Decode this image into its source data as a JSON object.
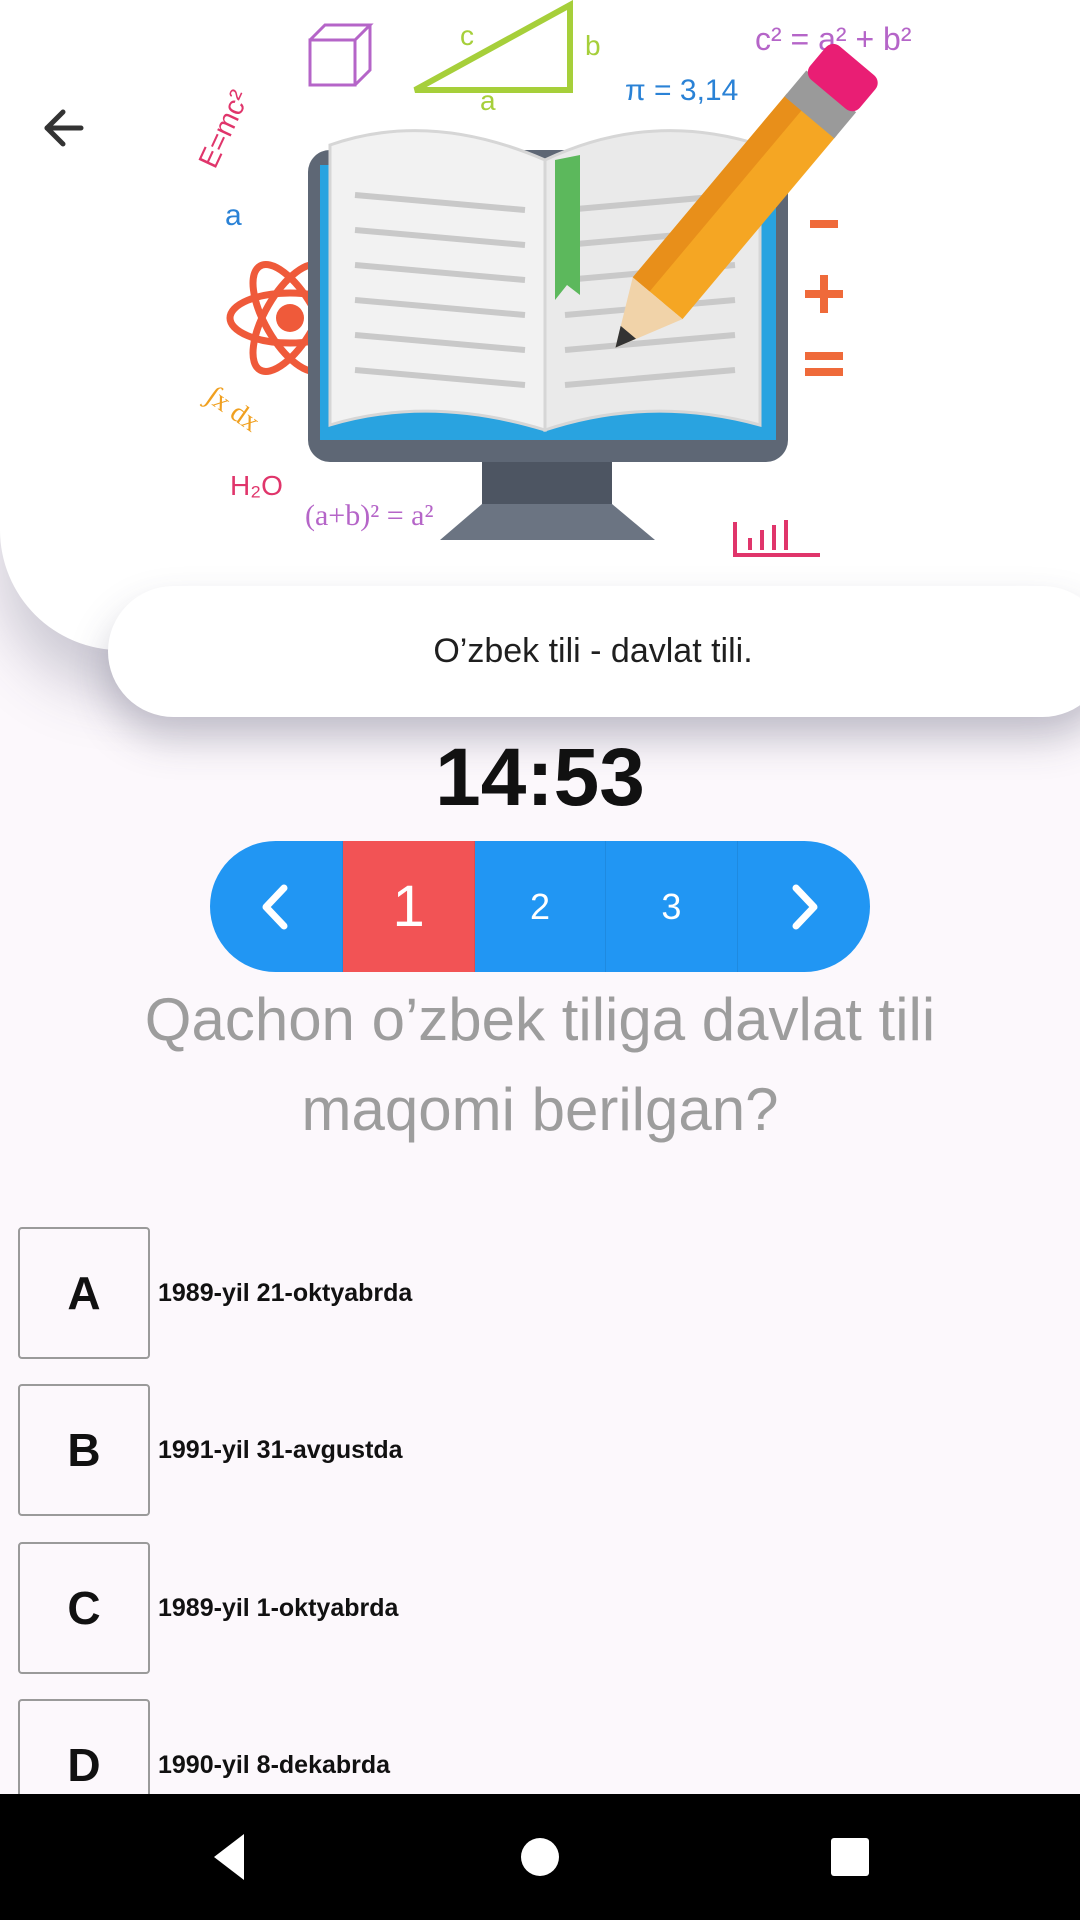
{
  "header": {
    "back_icon": "arrow-left-icon",
    "illustration": "book-on-monitor-with-pencil-and-formulas",
    "formula_text": [
      "E=mc²",
      "π = 3,14",
      "c² = a² + b²",
      "H₂O",
      "(a+b)² = a²",
      "∫x dx"
    ]
  },
  "topic": {
    "title": "O’zbek tili - davlat tili."
  },
  "timer": {
    "value": "14:53"
  },
  "pager": {
    "prev_icon": "chevron-left-icon",
    "next_icon": "chevron-right-icon",
    "pages": [
      "1",
      "2",
      "3"
    ],
    "current": "1",
    "active_color": "#f25355",
    "color": "#2196f3"
  },
  "question": {
    "text": "Qachon o’zbek tiliga davlat tili maqomi berilgan?"
  },
  "answers": [
    {
      "letter": "A",
      "text": "1989-yil 21-oktyabrda"
    },
    {
      "letter": "B",
      "text": "1991-yil 31-avgustda"
    },
    {
      "letter": "C",
      "text": "1989-yil 1-oktyabrda"
    },
    {
      "letter": "D",
      "text": "1990-yil 8-dekabrda"
    }
  ],
  "system_nav": {
    "back_icon": "nav-back-triangle-icon",
    "home_icon": "nav-home-circle-icon",
    "recents_icon": "nav-recents-square-icon"
  }
}
